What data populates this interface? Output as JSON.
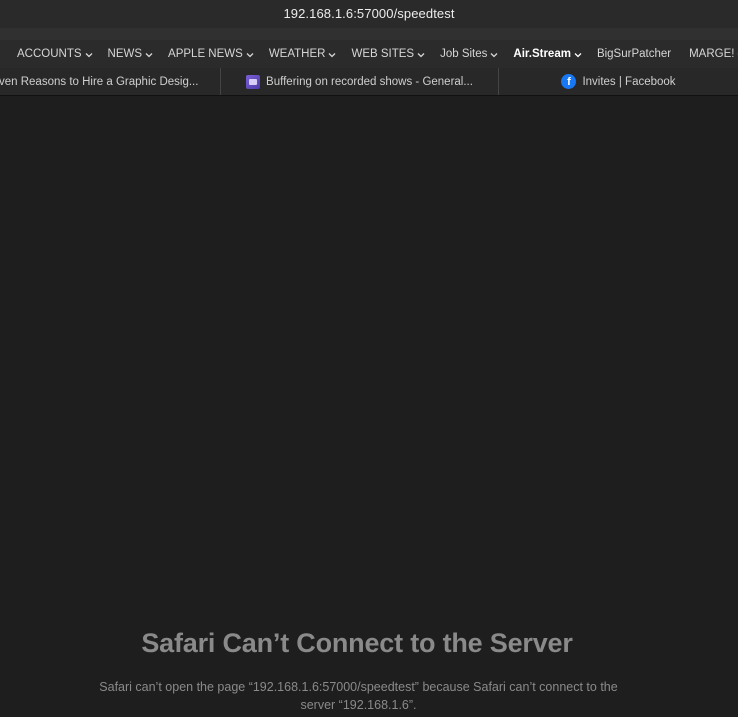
{
  "address_bar": {
    "url": "192.168.1.6:57000/speedtest"
  },
  "bookmarks": [
    {
      "label": "ACCOUNTS",
      "has_menu": true,
      "bold": false
    },
    {
      "label": "NEWS",
      "has_menu": true,
      "bold": false
    },
    {
      "label": "APPLE NEWS",
      "has_menu": true,
      "bold": false
    },
    {
      "label": "WEATHER",
      "has_menu": true,
      "bold": false
    },
    {
      "label": "WEB SITES",
      "has_menu": true,
      "bold": false
    },
    {
      "label": "Job Sites",
      "has_menu": true,
      "bold": false
    },
    {
      "label": "Air.Stream",
      "has_menu": true,
      "bold": true
    },
    {
      "label": "BigSurPatcher",
      "has_menu": false,
      "bold": false
    },
    {
      "label": "MARGE!",
      "has_menu": true,
      "bold": false
    }
  ],
  "tabs": [
    {
      "title": "ven Reasons to Hire a Graphic Desig...",
      "icon": "none"
    },
    {
      "title": "Buffering on recorded shows - General...",
      "icon": "buffer-favicon-icon"
    },
    {
      "title": "Invites | Facebook",
      "icon": "facebook-icon"
    }
  ],
  "error": {
    "title": "Safari Can’t Connect to the Server",
    "message": "Safari can’t open the page “192.168.1.6:57000/speedtest” because Safari can’t connect to the server “192.168.1.6”."
  },
  "colors": {
    "background": "#1e1e1e",
    "facebook_blue": "#1877f2",
    "error_text": "#8a8a8a"
  }
}
